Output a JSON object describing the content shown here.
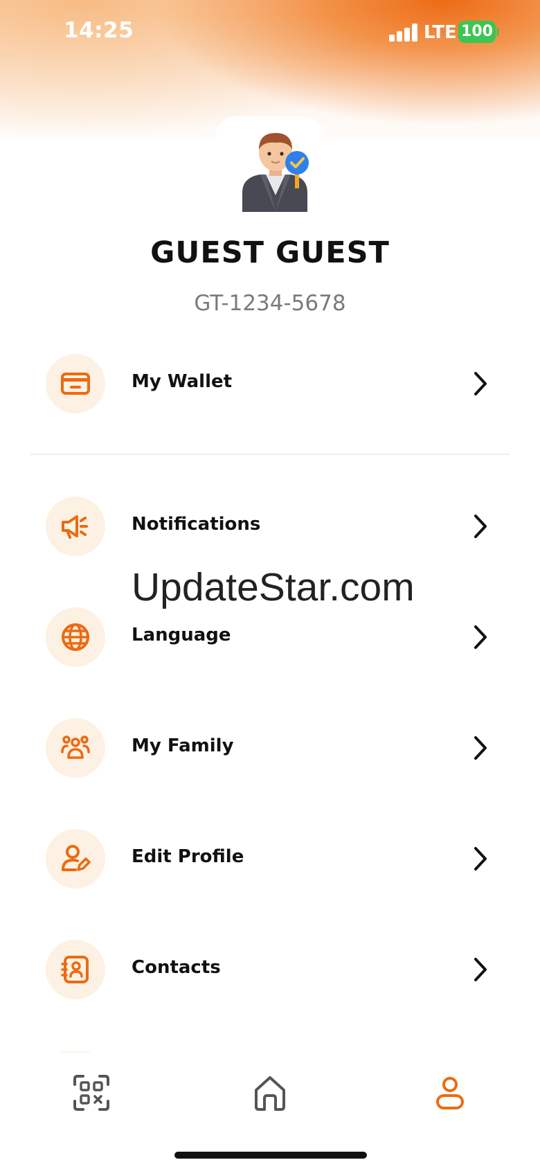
{
  "status_bar": {
    "time": "14:25",
    "network": "LTE",
    "battery": "100"
  },
  "profile": {
    "name": "GUEST GUEST",
    "id": "GT-1234-5678"
  },
  "menu": [
    {
      "label": "My Wallet",
      "icon": "wallet-icon"
    },
    {
      "label": "Notifications",
      "icon": "megaphone-icon"
    },
    {
      "label": "Language",
      "icon": "globe-icon"
    },
    {
      "label": "My Family",
      "icon": "family-icon"
    },
    {
      "label": "Edit Profile",
      "icon": "edit-profile-icon"
    },
    {
      "label": "Contacts",
      "icon": "contacts-icon"
    }
  ],
  "watermark": "UpdateStar.com",
  "tabbar": {
    "items": [
      "qr-scan-icon",
      "home-icon",
      "profile-icon"
    ],
    "active": "profile-icon"
  },
  "colors": {
    "accent": "#EC6A12",
    "icon_bg": "#FDF1E3",
    "battery": "#3CC552"
  }
}
